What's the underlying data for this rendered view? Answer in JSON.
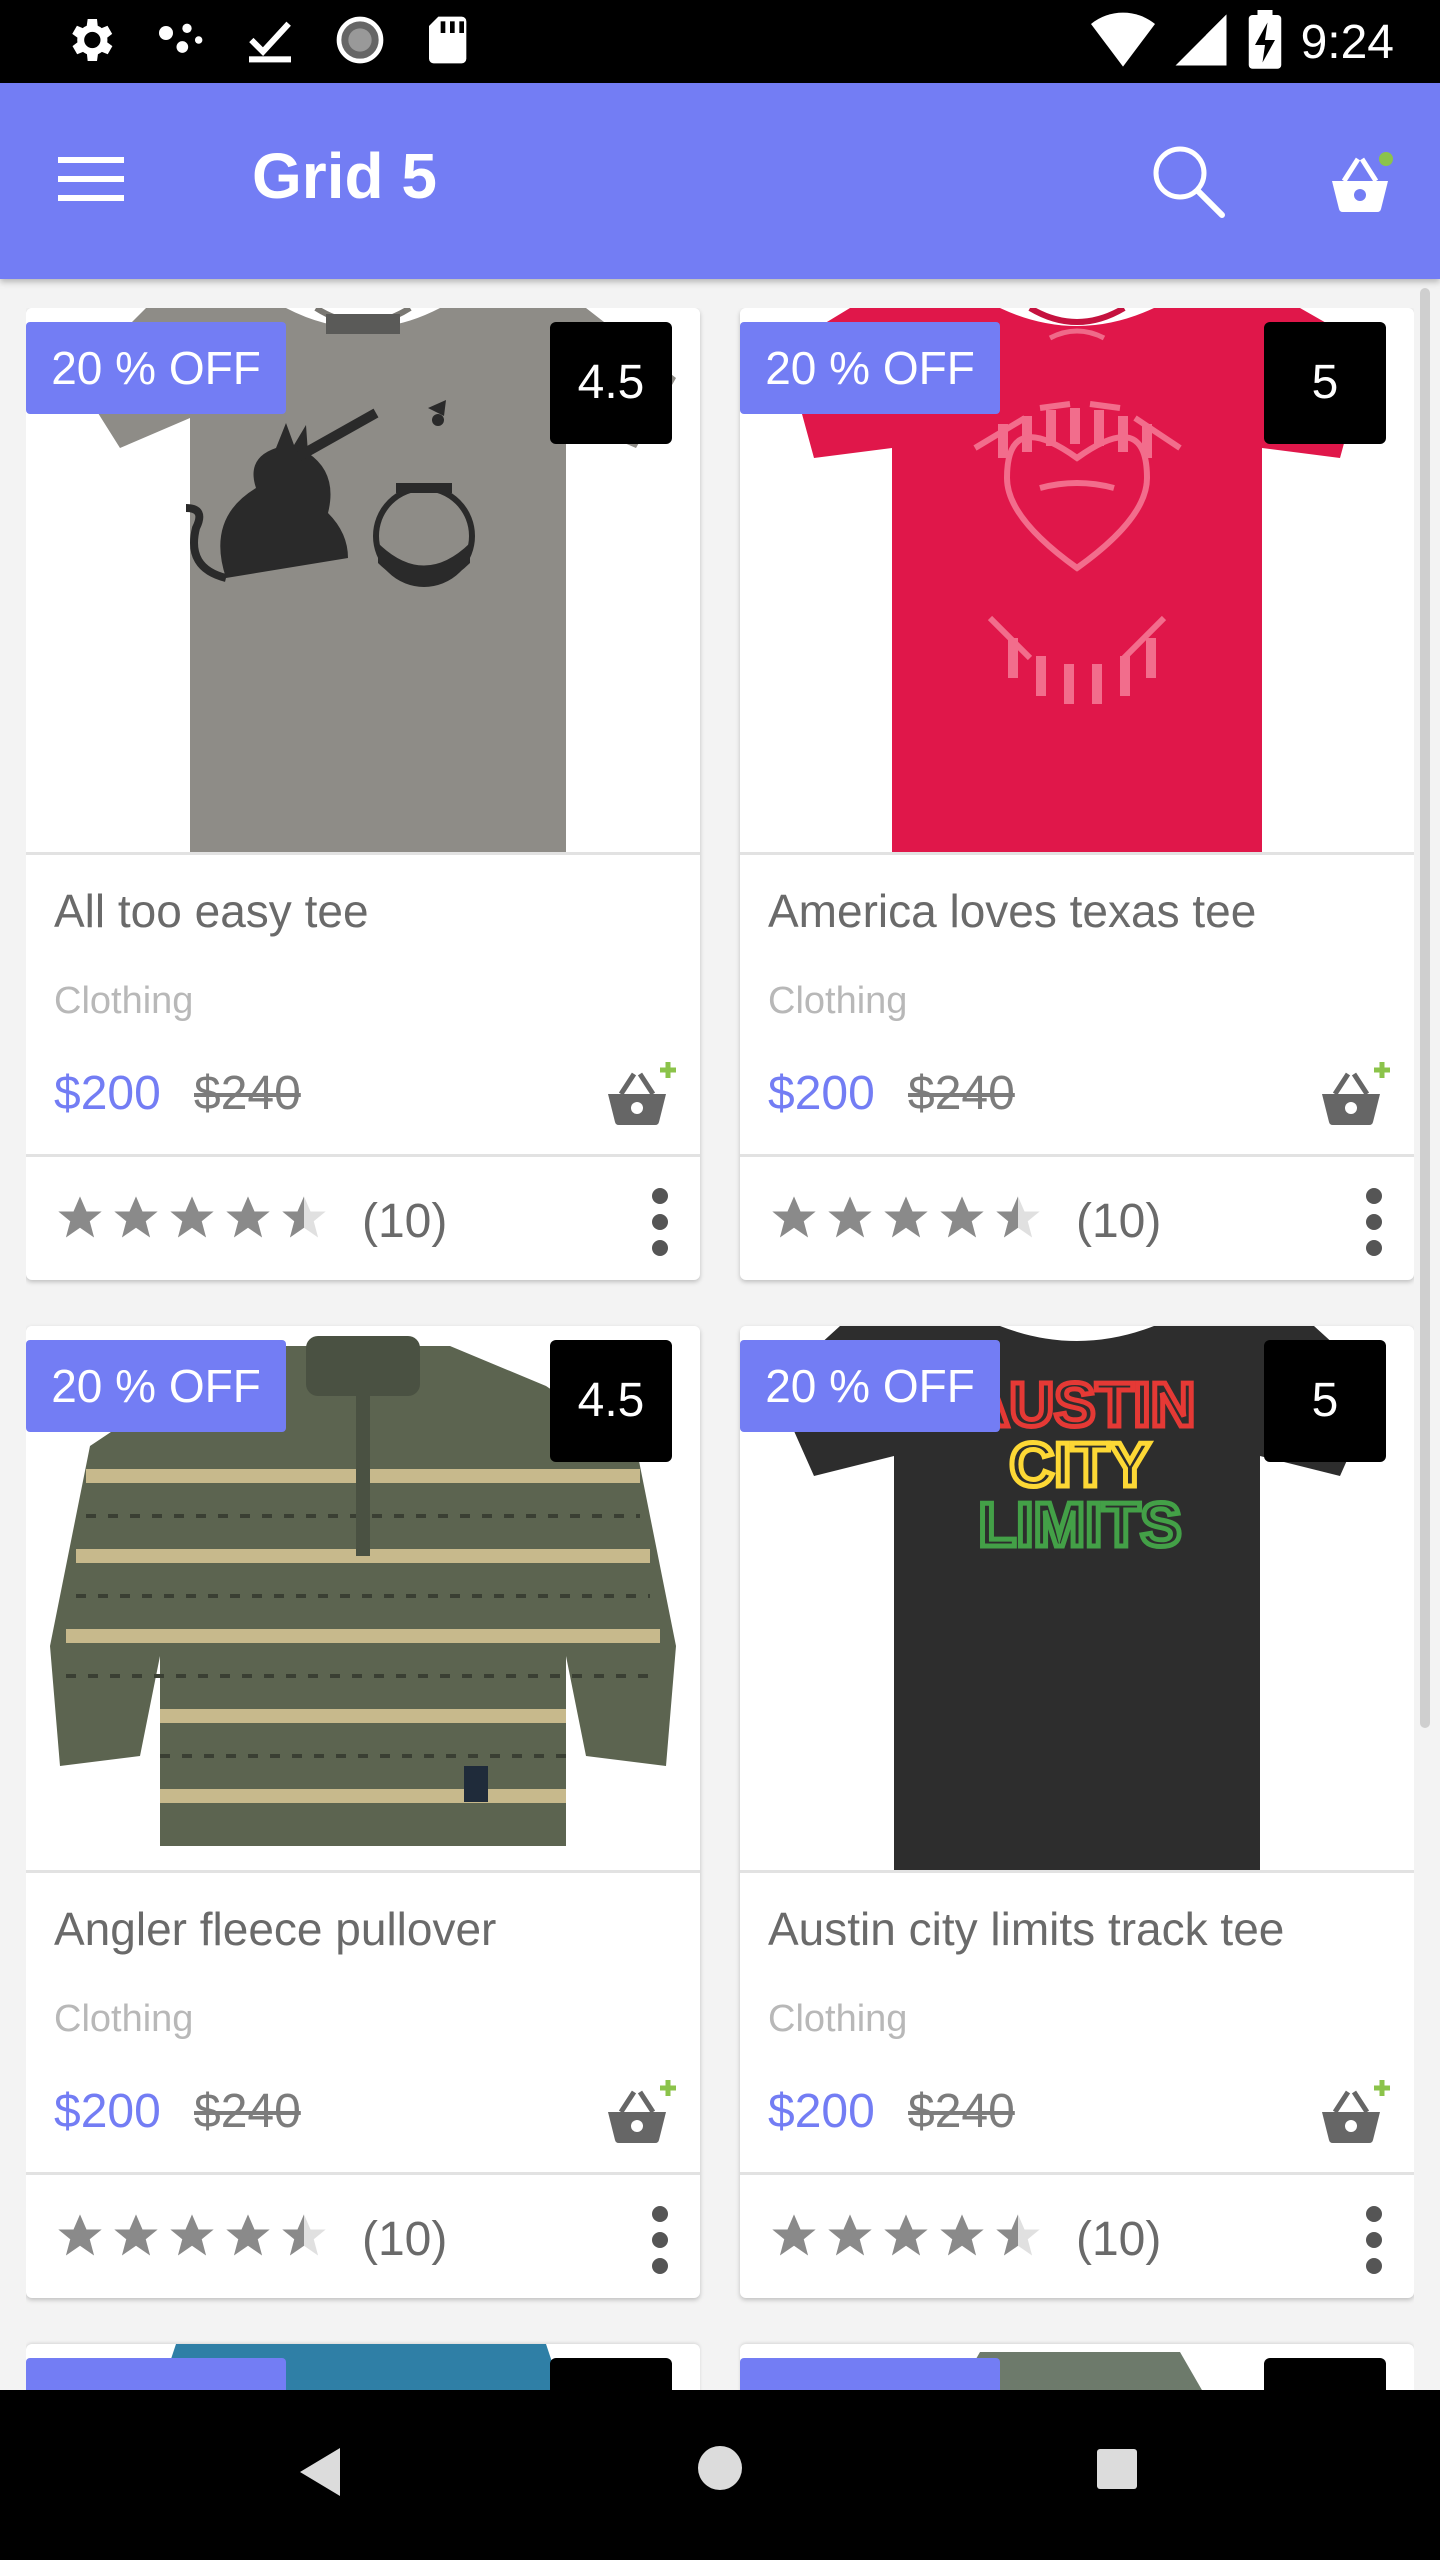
{
  "status_bar": {
    "time": "9:24",
    "left_icons": [
      "settings-icon",
      "dots-icon",
      "download-done-icon",
      "sync-icon",
      "sd-card-icon"
    ],
    "right_icons": [
      "wifi-icon",
      "signal-icon",
      "battery-charging-icon"
    ]
  },
  "app_bar": {
    "title": "Grid 5",
    "icons": [
      "menu-icon",
      "search-icon",
      "shopping-basket-icon"
    ],
    "cart_indicator_color": "#8bc34a",
    "background": "#737df4"
  },
  "products": [
    {
      "name": "All too easy tee",
      "category": "Clothing",
      "price": "$200",
      "old_price": "$240",
      "discount": "20 % OFF",
      "rating": "4.5",
      "stars": 4.5,
      "reviews": "(10)",
      "image": "grey-tshirt-cat-fishbowl"
    },
    {
      "name": "America loves texas tee",
      "category": "Clothing",
      "price": "$200",
      "old_price": "$240",
      "discount": "20 % OFF",
      "rating": "5",
      "stars": 4.5,
      "reviews": "(10)",
      "image": "red-tshirt-america-loves-texas"
    },
    {
      "name": "Angler fleece pullover",
      "category": "Clothing",
      "price": "$200",
      "old_price": "$240",
      "discount": "20 % OFF",
      "rating": "4.5",
      "stars": 4.5,
      "reviews": "(10)",
      "image": "fish-pattern-pullover"
    },
    {
      "name": "Austin city limits track tee",
      "category": "Clothing",
      "price": "$200",
      "old_price": "$240",
      "discount": "20 % OFF",
      "rating": "5",
      "stars": 4.5,
      "reviews": "(10)",
      "image": "black-tshirt-austin-city-limits",
      "image_text": [
        "AUSTIN",
        "CITY",
        "LIMITS"
      ]
    }
  ],
  "colors": {
    "accent": "#737df4",
    "price": "#737df4",
    "badge_bg": "#000000",
    "star": "#8a8a8a",
    "add_cart_plus": "#8bc34a"
  },
  "nav_bar": {
    "icons": [
      "back-icon",
      "home-icon",
      "recent-apps-icon"
    ]
  }
}
